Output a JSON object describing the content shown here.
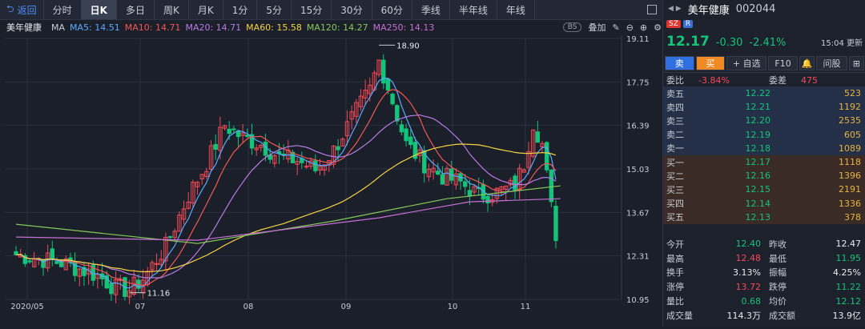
{
  "toolbar": {
    "back_label": "返回",
    "tabs": [
      "分时",
      "日K",
      "多日",
      "周K",
      "月K",
      "1分",
      "5分",
      "15分",
      "30分",
      "60分",
      "季线",
      "半年线",
      "年线"
    ],
    "active_tab": "日K"
  },
  "ma_bar": {
    "stock": "美年健康",
    "ma_label": "MA",
    "items": [
      {
        "label": "MA5: 14.51",
        "color": "#5aa9ff"
      },
      {
        "label": "MA10: 14.71",
        "color": "#f25757"
      },
      {
        "label": "MA20: 14.71",
        "color": "#b77be6"
      },
      {
        "label": "MA60: 15.58",
        "color": "#f5d442"
      },
      {
        "label": "MA120: 14.27",
        "color": "#86c95a"
      },
      {
        "label": "MA250: 14.13",
        "color": "#c86fd6"
      }
    ],
    "bs_label": "BS",
    "overlay_label": "叠加"
  },
  "chart_data": {
    "type": "candlestick",
    "y_ticks": [
      19.11,
      17.75,
      16.39,
      15.03,
      13.67,
      12.31,
      10.95
    ],
    "ylim": [
      10.95,
      19.11
    ],
    "x_ticks": [
      "2020/05",
      "07",
      "08",
      "09",
      "10",
      "11"
    ],
    "annotations": [
      {
        "label": "18.90",
        "value": 18.9
      },
      {
        "label": "11.16",
        "value": 11.16
      }
    ],
    "colors": {
      "up": "#f24957",
      "down": "#13c47a",
      "ma5": "#5aa9ff",
      "ma10": "#f25757",
      "ma20": "#b77be6",
      "ma60": "#f5d442",
      "ma120": "#86c95a",
      "ma250": "#c86fd6"
    }
  },
  "quote": {
    "name": "美年健康",
    "code": "002044",
    "badges": [
      {
        "label": "SZ",
        "color": "#e0342f"
      },
      {
        "label": "R",
        "color": "#3a6fd8"
      }
    ],
    "price": "12.17",
    "change": "-0.30",
    "change_pct": "-2.41%",
    "time": "15:04 更新",
    "buttons": [
      "卖",
      "买",
      "+ 自选",
      "F10",
      "",
      "问股",
      ""
    ],
    "wei_bi_label": "委比",
    "wei_bi": "-3.84%",
    "wei_cha_label": "委差",
    "wei_cha": "475"
  },
  "asks": [
    {
      "label": "卖五",
      "price": "12.22",
      "vol": "523"
    },
    {
      "label": "卖四",
      "price": "12.21",
      "vol": "1192"
    },
    {
      "label": "卖三",
      "price": "12.20",
      "vol": "2535"
    },
    {
      "label": "卖二",
      "price": "12.19",
      "vol": "605"
    },
    {
      "label": "卖一",
      "price": "12.18",
      "vol": "1089"
    }
  ],
  "bids": [
    {
      "label": "买一",
      "price": "12.17",
      "vol": "1118"
    },
    {
      "label": "买二",
      "price": "12.16",
      "vol": "1396"
    },
    {
      "label": "买三",
      "price": "12.15",
      "vol": "2191"
    },
    {
      "label": "买四",
      "price": "12.14",
      "vol": "1336"
    },
    {
      "label": "买五",
      "price": "12.13",
      "vol": "378"
    }
  ],
  "stats": [
    {
      "k": "今开",
      "v": "12.40",
      "vc": "green",
      "k2": "昨收",
      "v2": "12.47",
      "v2c": "white"
    },
    {
      "k": "最高",
      "v": "12.48",
      "vc": "red",
      "k2": "最低",
      "v2": "11.95",
      "v2c": "green"
    },
    {
      "k": "换手",
      "v": "3.13%",
      "vc": "white",
      "k2": "振幅",
      "v2": "4.25%",
      "v2c": "white"
    },
    {
      "k": "涨停",
      "v": "13.72",
      "vc": "red",
      "k2": "跌停",
      "v2": "11.22",
      "v2c": "green"
    },
    {
      "k": "量比",
      "v": "0.68",
      "vc": "green",
      "k2": "均价",
      "v2": "12.12",
      "v2c": "green"
    },
    {
      "k": "成交量",
      "v": "114.3万",
      "vc": "white",
      "k2": "成交额",
      "v2": "13.9亿",
      "v2c": "white"
    }
  ]
}
